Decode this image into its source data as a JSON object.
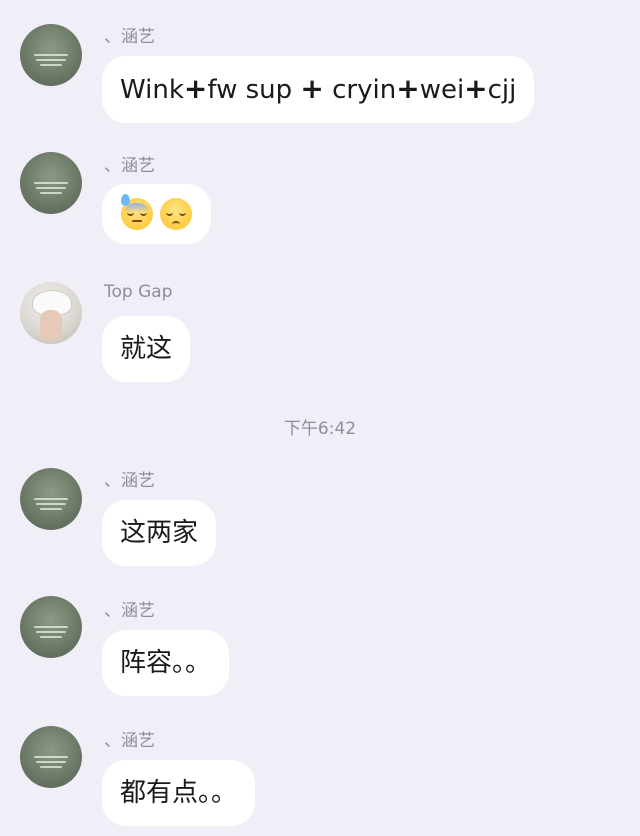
{
  "messages": [
    {
      "sender": "、涵艺",
      "parts": [
        "Wink",
        "+",
        "fw sup ",
        "+",
        " cryin",
        "+",
        "wei",
        "+",
        "cjj"
      ]
    },
    {
      "sender": "、涵艺",
      "emojis": [
        "downcast-sweat-face-emoji",
        "pensive-face-emoji"
      ]
    },
    {
      "sender": "Top Gap",
      "text": "就这"
    },
    {
      "sender": "、涵艺",
      "text": "这两家"
    },
    {
      "sender": "、涵艺",
      "text": "阵容。。"
    },
    {
      "sender": "、涵艺",
      "text": "都有点。。"
    }
  ],
  "timestamp": "下午6:42",
  "colors": {
    "background": "#f0eff7",
    "bubble": "#ffffff",
    "meta_text": "#8e8d99",
    "message_text": "#1a1a1a"
  }
}
